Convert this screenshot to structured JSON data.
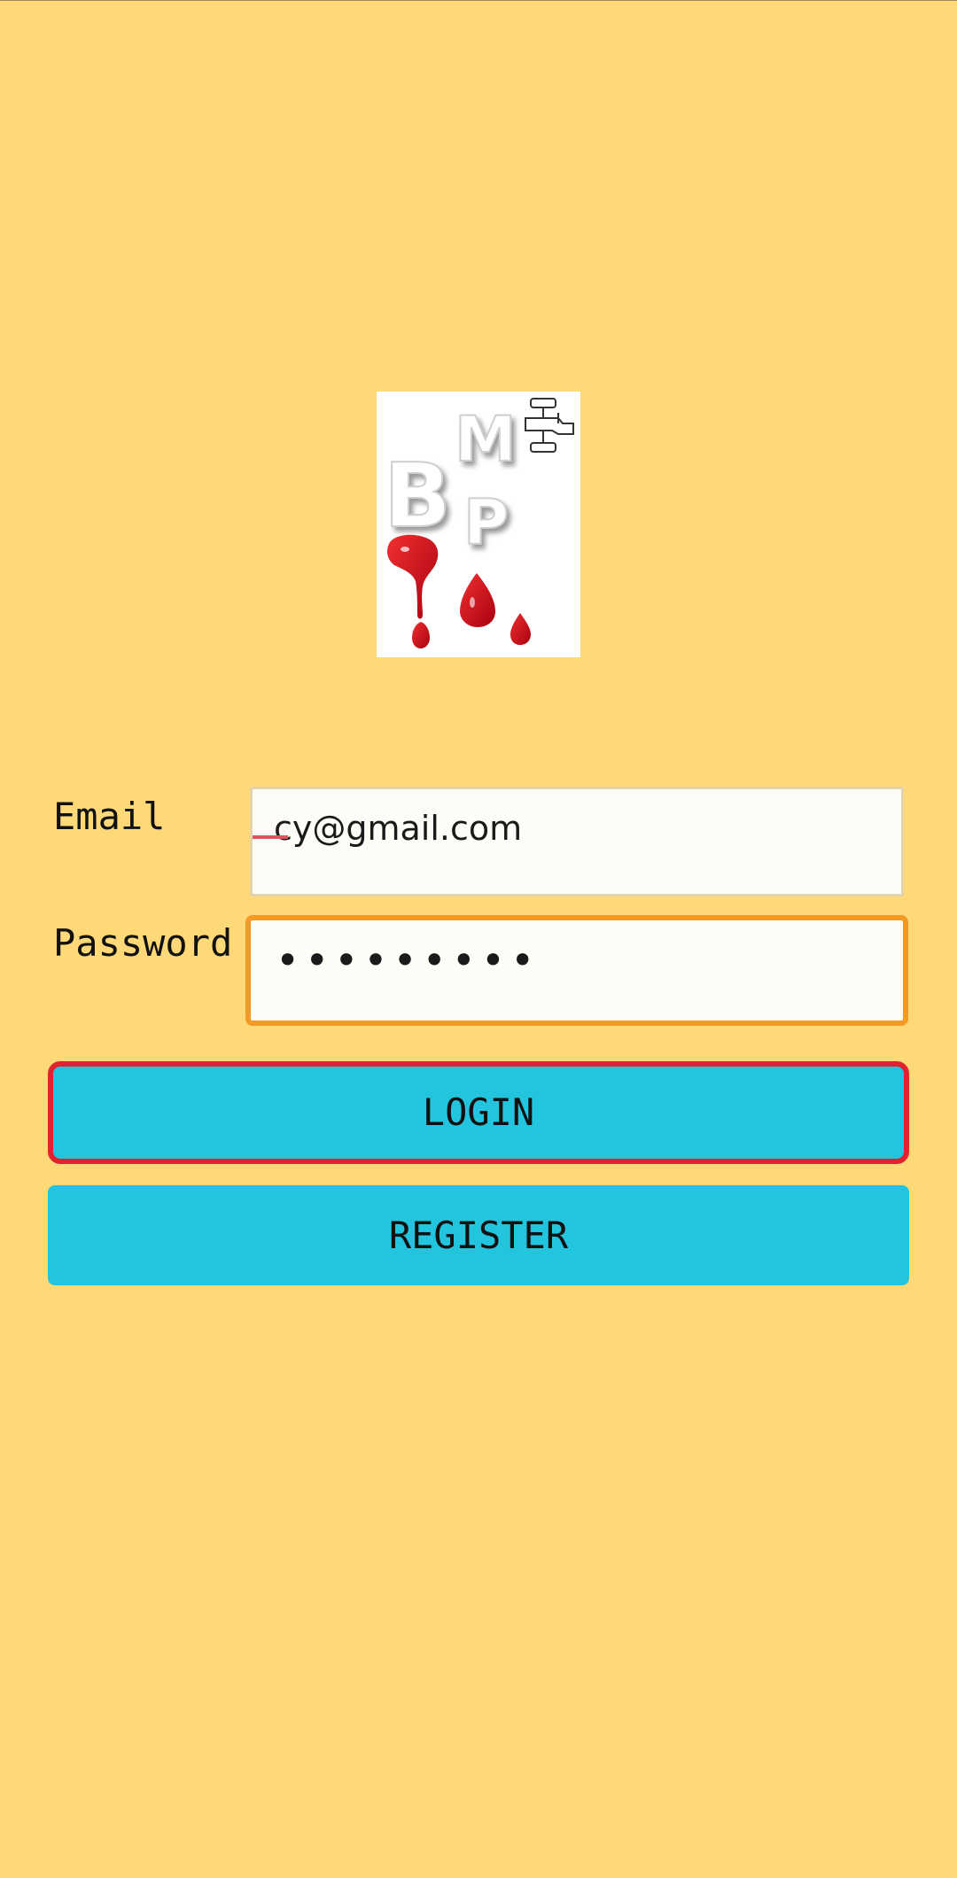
{
  "logo": {
    "name": "BMP",
    "letters": [
      "B",
      "M",
      "P"
    ]
  },
  "form": {
    "email_label": "Email",
    "email_value": "cy@gmail.com",
    "password_label": "Password",
    "password_masked": "•••••••••"
  },
  "buttons": {
    "login_label": "LOGIN",
    "register_label": "REGISTER"
  },
  "colors": {
    "background": "#FFD877",
    "button": "#22C4DE",
    "focus_border": "#F29A23",
    "highlight_border": "#E5212F",
    "blood_red": "#D0101A"
  }
}
